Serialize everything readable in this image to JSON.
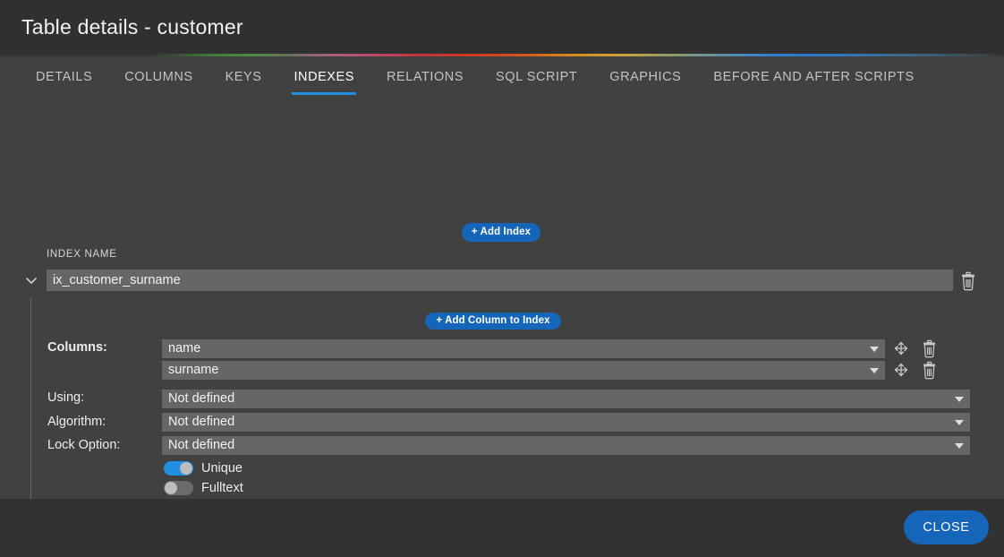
{
  "window": {
    "title": "Table details - customer"
  },
  "tabs": [
    {
      "label": "DETAILS",
      "active": false
    },
    {
      "label": "COLUMNS",
      "active": false
    },
    {
      "label": "KEYS",
      "active": false
    },
    {
      "label": "INDEXES",
      "active": true
    },
    {
      "label": "RELATIONS",
      "active": false
    },
    {
      "label": "SQL SCRIPT",
      "active": false
    },
    {
      "label": "GRAPHICS",
      "active": false
    },
    {
      "label": "BEFORE AND AFTER SCRIPTS",
      "active": false
    }
  ],
  "indexes_panel": {
    "add_index_label": "+ Add Index",
    "index_name_header": "INDEX NAME",
    "index_name_value": "ix_customer_surname",
    "add_column_label": "+ Add Column to Index",
    "labels": {
      "columns": "Columns:",
      "using": "Using:",
      "algorithm": "Algorithm:",
      "lock_option": "Lock Option:"
    },
    "columns": [
      {
        "value": "name"
      },
      {
        "value": "surname"
      }
    ],
    "using_value": "Not defined",
    "algorithm_value": "Not defined",
    "lock_option_value": "Not defined",
    "toggles": [
      {
        "label": "Unique",
        "on": true
      },
      {
        "label": "Fulltext",
        "on": false
      }
    ]
  },
  "footer": {
    "close_label": "CLOSE"
  },
  "colors": {
    "accent_blue": "#1565b8",
    "tab_underline": "#1f8fe0",
    "window_bg": "#414141",
    "titlebar_bg": "#303030",
    "input_bg": "#666666",
    "footer_bg": "#323232"
  }
}
